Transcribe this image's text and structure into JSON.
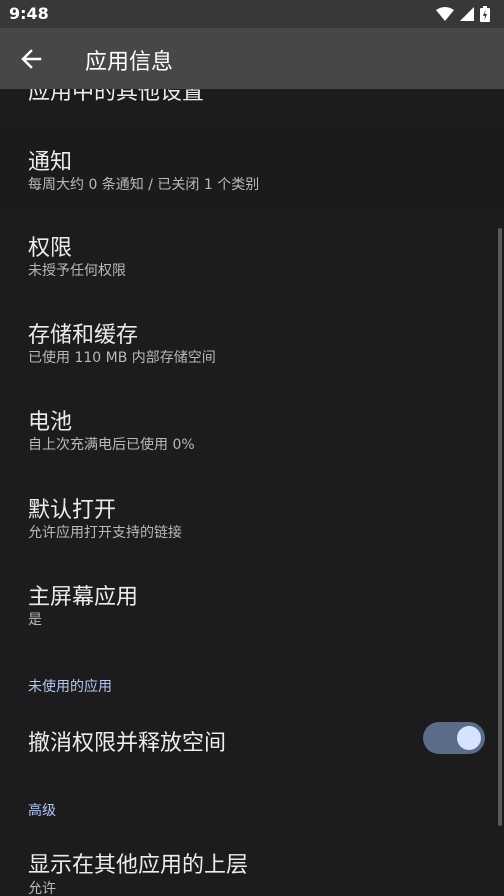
{
  "status_bar": {
    "time": "9:48",
    "icons": [
      "wifi-icon",
      "signal-icon",
      "battery-icon"
    ]
  },
  "app_bar": {
    "back_icon": "arrow-back-icon",
    "title": "应用信息"
  },
  "items": {
    "other_settings": {
      "title": "应用中的其他设置"
    },
    "notifications": {
      "title": "通知",
      "summary": "每周大约 0 条通知 / 已关闭 1 个类别"
    },
    "permissions": {
      "title": "权限",
      "summary": "未授予任何权限"
    },
    "storage": {
      "title": "存储和缓存",
      "summary": "已使用 110 MB 内部存储空间"
    },
    "battery": {
      "title": "电池",
      "summary": "自上次充满电后已使用 0%"
    },
    "open_by_default": {
      "title": "默认打开",
      "summary": "允许应用打开支持的链接"
    },
    "home_app": {
      "title": "主屏幕应用",
      "summary": "是"
    },
    "unused_section": {
      "header": "未使用的应用"
    },
    "revoke_permissions": {
      "title": "撤消权限并释放空间",
      "enabled": true
    },
    "advanced_section": {
      "header": "高级"
    },
    "display_over": {
      "title": "显示在其他应用的上层",
      "summary": "允许"
    }
  },
  "colors": {
    "background": "#1c1c1e",
    "app_bar": "#47474a",
    "accent": "#b4c6f2",
    "toggle_track": "#5b6b8a",
    "toggle_thumb": "#d6e3ff"
  }
}
